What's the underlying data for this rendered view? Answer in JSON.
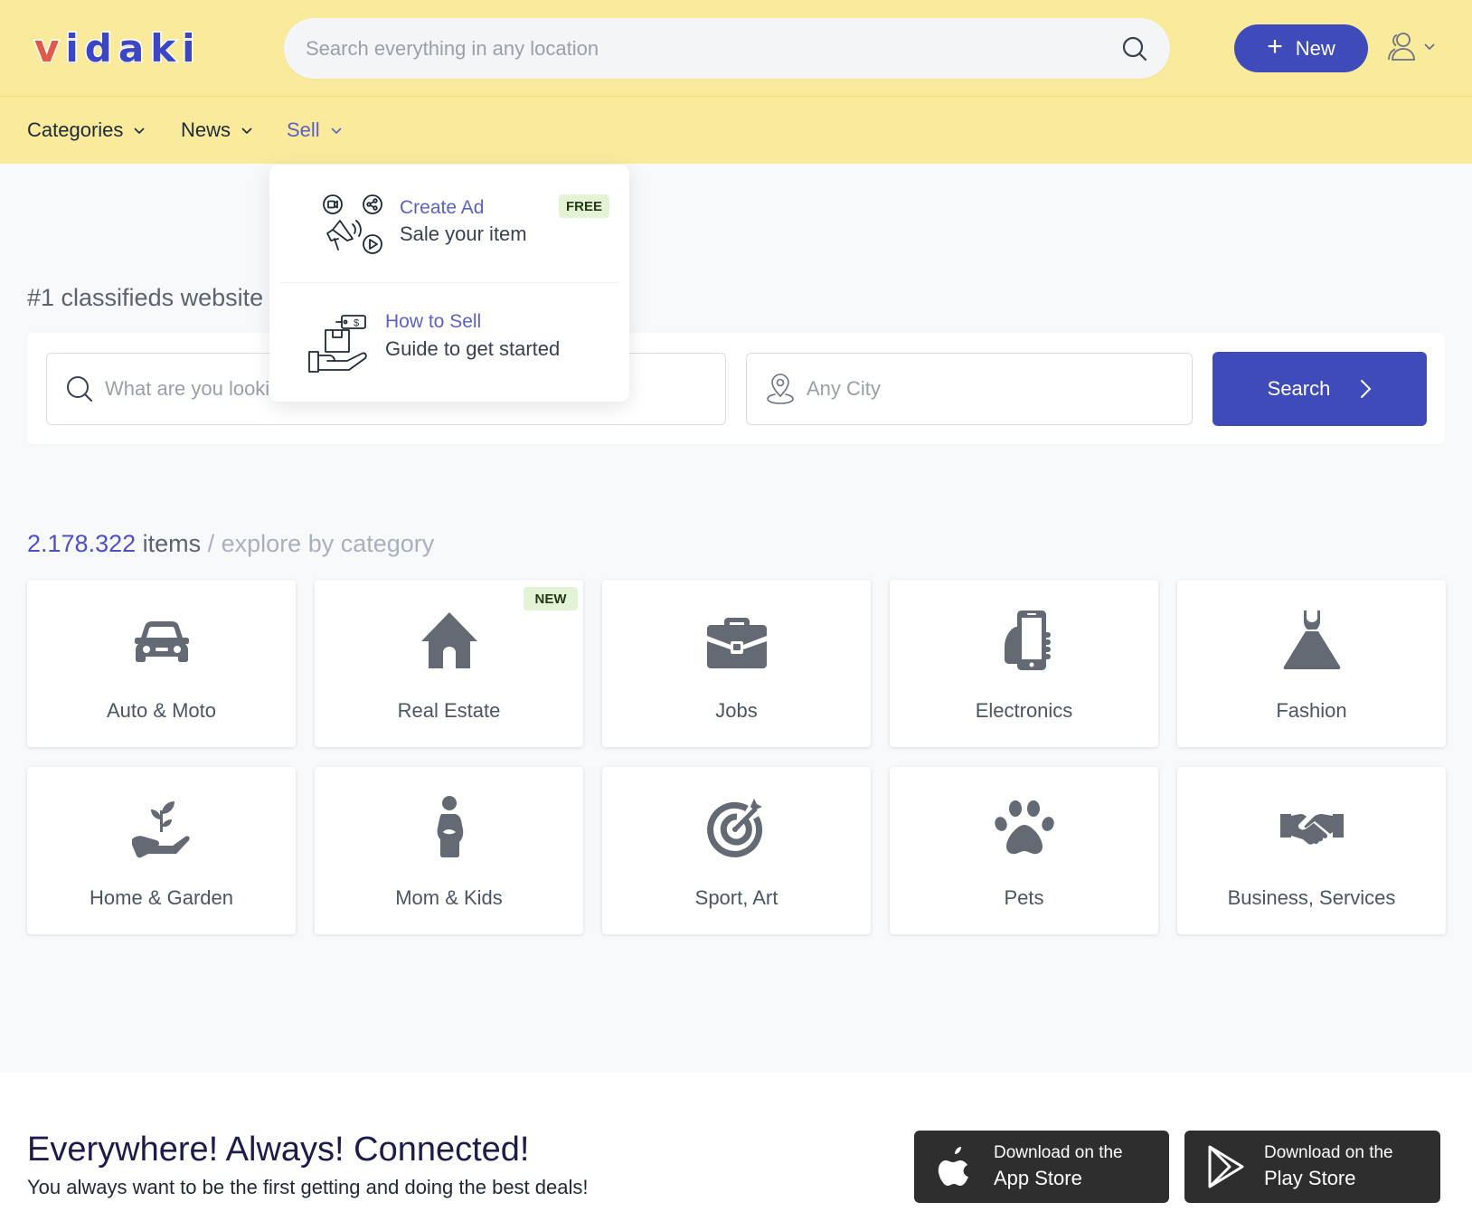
{
  "header": {
    "logo_letters": [
      "v",
      "i",
      "d",
      "a",
      "k",
      "i"
    ],
    "search_placeholder": "Search everything in any location",
    "new_button_label": "New"
  },
  "nav": {
    "items": [
      {
        "label": "Categories"
      },
      {
        "label": "News"
      },
      {
        "label": "Sell"
      }
    ]
  },
  "sell_menu": {
    "items": [
      {
        "title": "Create Ad",
        "subtitle": "Sale your item",
        "badge": "FREE"
      },
      {
        "title": "How to Sell",
        "subtitle": "Guide to get started"
      }
    ]
  },
  "hero": {
    "title": "#1 classifieds website",
    "what_placeholder": "What are you looking for?",
    "where_placeholder": "Any City",
    "search_button_label": "Search"
  },
  "categories_section": {
    "count": "2.178.322",
    "items_word": " items",
    "separator_text": " / explore by category",
    "items": [
      {
        "label": "Auto & Moto",
        "icon": "car-icon"
      },
      {
        "label": "Real Estate",
        "icon": "house-icon",
        "badge": "NEW"
      },
      {
        "label": "Jobs",
        "icon": "briefcase-icon"
      },
      {
        "label": "Electronics",
        "icon": "phone-hand-icon"
      },
      {
        "label": "Fashion",
        "icon": "dress-icon"
      },
      {
        "label": "Home & Garden",
        "icon": "plant-hand-icon"
      },
      {
        "label": "Mom & Kids",
        "icon": "pregnant-woman-icon"
      },
      {
        "label": "Sport, Art",
        "icon": "target-icon"
      },
      {
        "label": "Pets",
        "icon": "paw-icon"
      },
      {
        "label": "Business, Services",
        "icon": "handshake-icon"
      }
    ]
  },
  "footer": {
    "title": "Everywhere! Always! Connected!",
    "subtitle": "You always want to be the first getting and doing the best deals!",
    "app_store": {
      "line1": "Download on the",
      "line2": "App Store"
    },
    "play_store": {
      "line1": "Download on the",
      "line2": "Play Store"
    }
  },
  "colors": {
    "header_bg": "#f9ea9c",
    "primary": "#3f4bb9",
    "accent_text": "#5b62c6",
    "badge_bg": "#e4f3d6",
    "icon_gray": "#636a73"
  }
}
